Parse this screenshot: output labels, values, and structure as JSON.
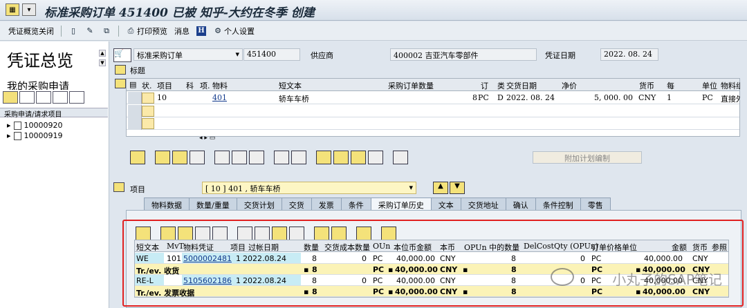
{
  "window": {
    "title": "标准采购订单 451400 已被 知乎-大约在冬季 创建"
  },
  "toolbar": {
    "overview_close": "凭证概览关闭",
    "print_preview": "打印预览",
    "messages": "消息",
    "personal_settings": "个人设置"
  },
  "left": {
    "title": "凭证总览",
    "subtitle": "我的采购申请",
    "tree_header": "采购申请/请求项目",
    "tree_items": [
      "10000920",
      "10000919"
    ]
  },
  "header": {
    "doc_type": "标准采购订单",
    "po_number": "451400",
    "vendor_label": "供应商",
    "vendor_value": "400002 吉亚汽车零部件",
    "doc_date_label": "凭证日期",
    "doc_date_value": "2022. 08. 24",
    "header_label": "标题"
  },
  "items_grid": {
    "columns": [
      "状.",
      "项目",
      "科",
      "项.",
      "物料",
      "短文本",
      "采购订单数量",
      "订",
      "类",
      "交货日期",
      "净价",
      "货币",
      "每",
      "单位",
      "物料组"
    ],
    "row": {
      "item": "10",
      "material": "401",
      "short_text": "轿车车桥",
      "qty": "8",
      "unit": "PC",
      "cat": "D",
      "delivery": "2022. 08. 24",
      "net_price": "5, 000. 00",
      "currency": "CNY",
      "per": "1",
      "order_unit": "PC",
      "mat_group": "直接外购"
    }
  },
  "buttons": {
    "planning_edit": "附加计划编制"
  },
  "item_detail": {
    "label": "项目",
    "selected": "[ 10 ] 401 , 轿车车桥",
    "tabs": [
      "物料数据",
      "数量/重量",
      "交货计划",
      "交货",
      "发票",
      "条件",
      "采购订单历史",
      "文本",
      "交货地址",
      "确认",
      "条件控制",
      "零售"
    ],
    "active_tab": "采购订单历史"
  },
  "history_grid": {
    "columns": [
      "短文本",
      "MvT",
      "物料凭证",
      "项目",
      "过帐日期",
      "数量",
      "交货成本数量",
      "OUn",
      "本位币金额",
      "本币",
      "OPUn 中的数量",
      "DelCostQty (OPUn)",
      "订单价格单位",
      "金额",
      "货币",
      "参照"
    ],
    "rows": [
      {
        "type": "row",
        "text": "WE",
        "mvt": "101",
        "doc": "5000002481",
        "item": "1",
        "date": "2022.08.24",
        "qty": "8",
        "dcq": "0",
        "oun": "PC",
        "amount_lc": "40,000.00",
        "lc": "CNY",
        "opun_qty": "8",
        "dcq_opun": "0",
        "opu": "PC",
        "amount": "40,000.00",
        "cur": "CNY"
      },
      {
        "type": "sum",
        "text": "Tr./ev. 收货",
        "qty": "8",
        "oun": "PC",
        "amount_lc": "40,000.00",
        "lc": "CNY",
        "opun_qty": "8",
        "opu": "PC",
        "amount": "40,000.00",
        "cur": "CNY"
      },
      {
        "type": "row",
        "text": "RE-L",
        "mvt": "",
        "doc": "5105602186",
        "item": "1",
        "date": "2022.08.24",
        "qty": "8",
        "dcq": "0",
        "oun": "PC",
        "amount_lc": "40,000.00",
        "lc": "CNY",
        "opun_qty": "8",
        "dcq_opun": "0",
        "opu": "PC",
        "amount": "40,000.00",
        "cur": "CNY"
      },
      {
        "type": "sum",
        "text": "Tr./ev. 发票收据",
        "qty": "8",
        "oun": "PC",
        "amount_lc": "40,000.00",
        "lc": "CNY",
        "opun_qty": "8",
        "opu": "PC",
        "amount": "40,000.00",
        "cur": "CNY"
      }
    ]
  },
  "watermark": "小丸子的SAP笔记"
}
